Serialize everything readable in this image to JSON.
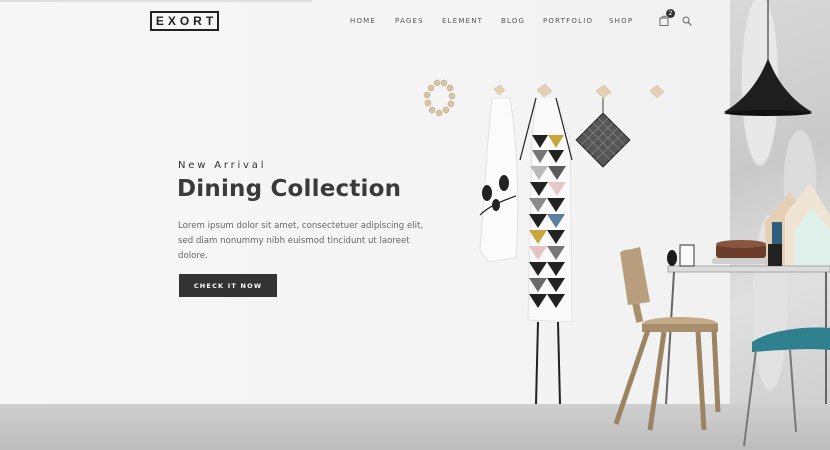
{
  "header": {
    "logo_text": "EXORT",
    "nav": [
      "HOME",
      "PAGES",
      "ELEMENT",
      "BLOG",
      "PORTFOLIO",
      "SHOP"
    ],
    "cart_count": "2",
    "cart_icon": "shopping-bag-icon",
    "search_icon": "search-icon"
  },
  "hero": {
    "eyebrow": "New Arrival",
    "title": "Dining Collection",
    "description": "Lorem ipsum dolor sit amet, consectetuer adipiscing elit, sed diam nonummy nibh euismod tincidunt ut laoreet dolore.",
    "cta_label": "CHECK IT NOW"
  },
  "colors": {
    "dark": "#333333",
    "background": "#f4f4f4",
    "floor": "#c4c4c4",
    "chair_teal": "#2f7f8f"
  }
}
